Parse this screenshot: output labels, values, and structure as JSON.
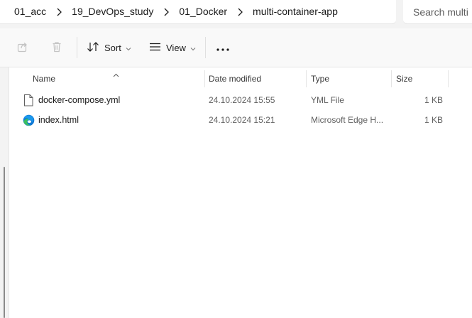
{
  "address_bar": {
    "breadcrumbs": [
      "01_acc",
      "19_DevOps_study",
      "01_Docker",
      "multi-container-app"
    ]
  },
  "search": {
    "placeholder": "Search multi"
  },
  "toolbar": {
    "share_icon": "share-icon",
    "delete_icon": "trash-icon",
    "sort_label": "Sort",
    "view_label": "View",
    "more_icon": "more-icon"
  },
  "columns": {
    "name": "Name",
    "date_modified": "Date modified",
    "type": "Type",
    "size": "Size"
  },
  "files": [
    {
      "name": "docker-compose.yml",
      "date": "24.10.2024 15:55",
      "type": "YML File",
      "size": "1 KB",
      "icon": "document-icon"
    },
    {
      "name": "index.html",
      "date": "24.10.2024 15:21",
      "type": "Microsoft Edge H...",
      "size": "1 KB",
      "icon": "edge-icon"
    }
  ],
  "colors": {
    "chrome_bg": "#f3f3f3",
    "toolbar_bg": "#f9f9f9",
    "text": "#1a1a1a",
    "muted_text": "#5f5f5f",
    "edge_blue": "#0f78d4",
    "edge_green": "#3bbf5e"
  }
}
